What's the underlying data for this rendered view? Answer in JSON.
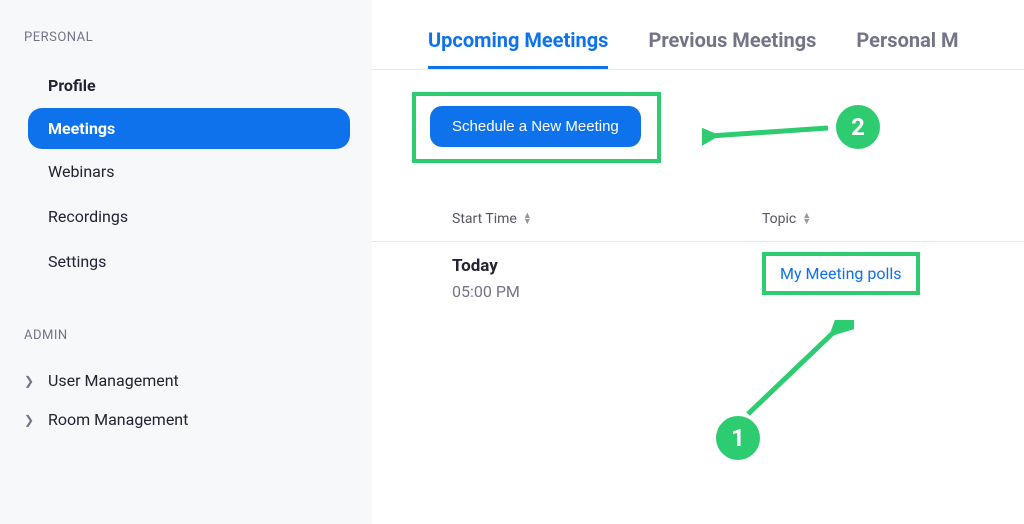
{
  "sidebar": {
    "personal_label": "PERSONAL",
    "items": [
      {
        "label": "Profile"
      },
      {
        "label": "Meetings"
      },
      {
        "label": "Webinars"
      },
      {
        "label": "Recordings"
      },
      {
        "label": "Settings"
      }
    ],
    "admin_label": "ADMIN",
    "admin_items": [
      {
        "label": "User Management"
      },
      {
        "label": "Room Management"
      }
    ]
  },
  "tabs": [
    {
      "label": "Upcoming Meetings",
      "active": true
    },
    {
      "label": "Previous Meetings",
      "active": false
    },
    {
      "label": "Personal M",
      "active": false
    }
  ],
  "schedule_button": "Schedule a New Meeting",
  "table": {
    "headers": {
      "start": "Start Time",
      "topic": "Topic"
    },
    "rows": [
      {
        "date": "Today",
        "time": "05:00 PM",
        "topic": "My Meeting polls"
      }
    ]
  },
  "callouts": {
    "one": "1",
    "two": "2"
  },
  "colors": {
    "primary": "#0e72ed",
    "highlight": "#2ecc71",
    "muted": "#747487"
  }
}
